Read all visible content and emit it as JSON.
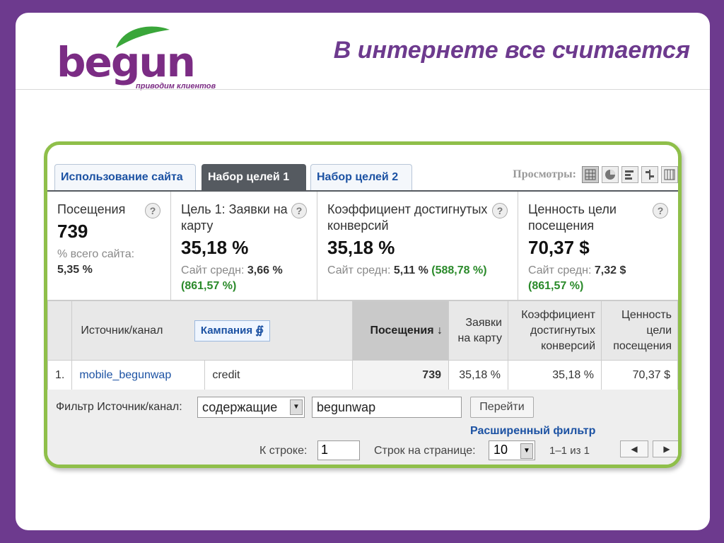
{
  "logo": {
    "word": "begun",
    "tagline": "приводим клиентов"
  },
  "slide_title": "В интернете все считается",
  "tabs": [
    {
      "label": "Использование сайта"
    },
    {
      "label": "Набор целей 1"
    },
    {
      "label": "Набор целей 2"
    }
  ],
  "views": {
    "label": "Просмотры:"
  },
  "metrics": [
    {
      "label": "Посещения",
      "value": "739",
      "sub1": "% всего сайта:",
      "sub2": "5,35 %"
    },
    {
      "label": "Цель 1: Заявки на карту",
      "value": "35,18 %",
      "sub1": "Сайт средн:",
      "sub1_val": "3,66 %",
      "sub2": "(861,57 %)"
    },
    {
      "label": "Коэффициент достигнутых конверсий",
      "value": "35,18 %",
      "sub1": "Сайт средн:",
      "sub1_val": "5,11 %",
      "sub2": "(588,78 %)"
    },
    {
      "label": "Ценность цели посещения",
      "value": "70,37 $",
      "sub1": "Сайт средн:",
      "sub1_val": "7,32 $",
      "sub2": "(861,57 %)"
    }
  ],
  "help_glyph": "?",
  "table": {
    "col_source": "Источник/канал",
    "campaign_select": "Кампания",
    "col_visits": "Посещения",
    "col_requests": "Заявки на карту",
    "col_conv": "Коэффициент достигнутых конверсий",
    "col_value": "Ценность цели посещения",
    "rows": [
      {
        "num": "1.",
        "source": "mobile_begunwap",
        "campaign": "credit",
        "visits": "739",
        "requests": "35,18 %",
        "conv": "35,18 %",
        "value": "70,37 $"
      }
    ]
  },
  "filter": {
    "label": "Фильтр Источник/канал:",
    "mode": "содержащие",
    "query": "begunwap",
    "go_label": "Перейти",
    "advanced": "Расширенный фильтр",
    "goto_label": "К строке:",
    "goto_value": "1",
    "rows_label": "Строк на странице:",
    "rows_value": "10",
    "range": "1–1 из 1"
  },
  "colors": {
    "background": "#6d3a8e",
    "frame_border": "#8fbf4a",
    "link": "#1c52a3",
    "positive": "#2a8a2a"
  }
}
